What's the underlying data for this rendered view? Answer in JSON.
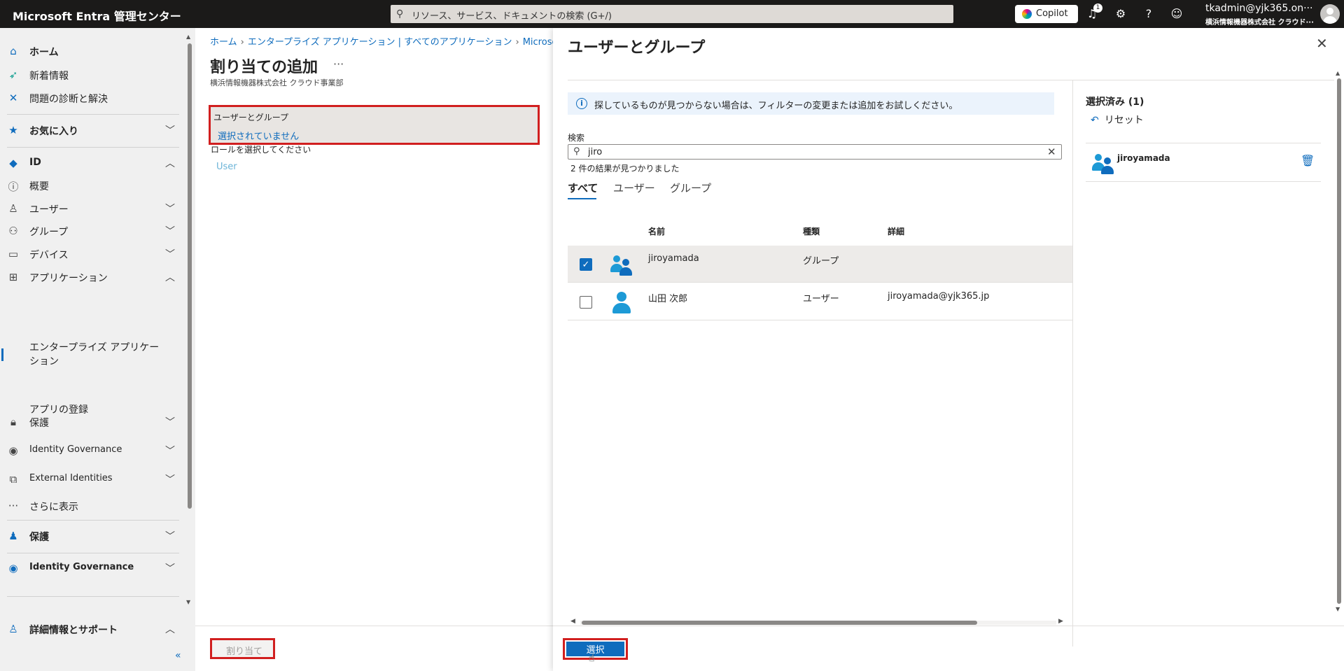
{
  "topbar": {
    "brand": "Microsoft Entra 管理センター",
    "search_placeholder": "リソース、サービス、ドキュメントの検索 (G+/)",
    "copilot_label": "Copilot",
    "notification_count": "1",
    "user_name": "tkadmin@yjk365.on···",
    "user_org": "横浜情報機器株式会社 クラウド···"
  },
  "nav": {
    "home": "ホーム",
    "whats_new": "新着情報",
    "diagnose": "問題の診断と解決",
    "favorites": "お気に入り",
    "identity": "ID",
    "overview": "概要",
    "users": "ユーザー",
    "groups": "グループ",
    "devices": "デバイス",
    "applications": "アプリケーション",
    "enterprise_apps": "エンタープライズ アプリケーション",
    "app_registrations": "アプリの登録",
    "protection": "保護",
    "identity_governance": "Identity Governance",
    "external_identities": "External Identities",
    "show_more": "さらに表示",
    "protection_section": "保護",
    "identity_governance_section": "Identity Governance",
    "learn_support": "詳細情報とサポート",
    "collapse": "«"
  },
  "main": {
    "breadcrumb": [
      "ホーム",
      "エンタープライズ アプリケーション | すべてのアプリケーション",
      "Microsoft Entra"
    ],
    "title": "割り当ての追加",
    "more": "···",
    "subtitle": "横浜情報機器株式会社 クラウド事業部",
    "users_groups_label": "ユーザーとグループ",
    "users_groups_value": "選択されていません",
    "role_label": "ロールを選択してください",
    "role_value": "User",
    "assign_button": "割り当て"
  },
  "panel": {
    "title": "ユーザーとグループ",
    "close": "✕",
    "info_text": "探しているものが見つからない場合は、フィルターの変更または追加をお試しください。",
    "search_label": "検索",
    "search_value": "jiro",
    "result_count": "2 件の結果が見つかりました",
    "tabs": [
      "すべて",
      "ユーザー",
      "グループ"
    ],
    "columns": {
      "name": "名前",
      "type": "種類",
      "details": "詳細"
    },
    "rows": [
      {
        "name": "jiroyamada",
        "type": "グループ",
        "details": "",
        "checked": true,
        "icon": "group-icon"
      },
      {
        "name": "山田 次郎",
        "type": "ユーザー",
        "details": "jiroyamada@yjk365.jp",
        "checked": false,
        "icon": "user-icon"
      }
    ],
    "selected_title": "選択済み (1)",
    "reset_label": "リセット",
    "selected_items": [
      {
        "name": "jiroyamada",
        "icon": "group-icon"
      }
    ],
    "select_button": "選択"
  },
  "colors": {
    "accent": "#0f6cbd",
    "highlight_border": "#d11f1f",
    "topbar": "#1b1a19",
    "nav_bg": "#f0f0f0"
  }
}
